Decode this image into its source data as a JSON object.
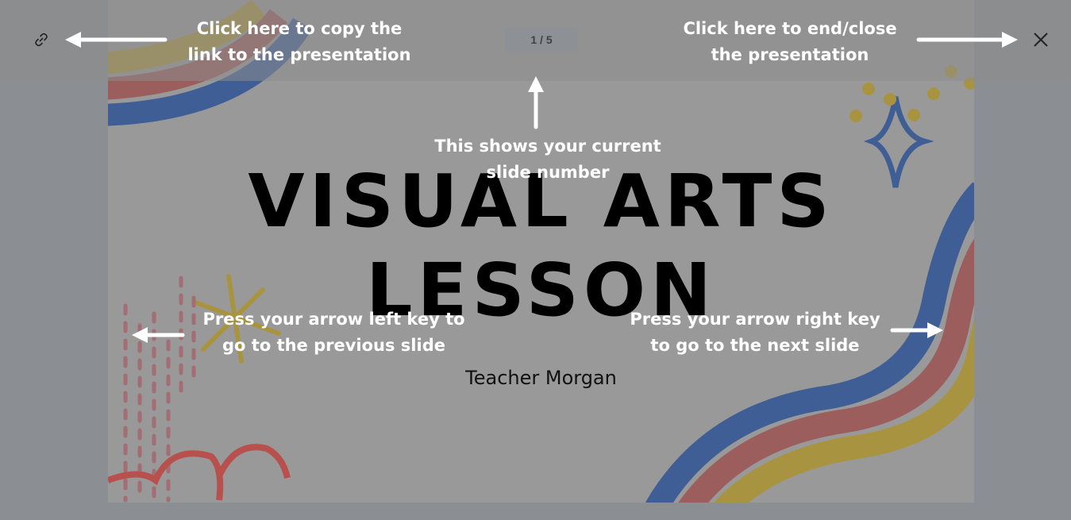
{
  "slide": {
    "title_line1": "VISUAL ARTS",
    "title_line2": "LESSON",
    "subtitle": "Teacher Morgan",
    "colors": {
      "background": "#9a9999",
      "blue": "#3f5e95",
      "red": "#9c5d5d",
      "yellow": "#a89440",
      "coral": "#b8504d"
    }
  },
  "toolbar": {
    "counter": "1 / 5",
    "link_icon": "link-icon",
    "close_icon": "close-icon"
  },
  "annotations": {
    "copy_link": [
      "Click here to copy the",
      "link to the presentation"
    ],
    "close": [
      "Click here to end/close",
      "the presentation"
    ],
    "slide_number": [
      "This shows your current",
      "slide number"
    ],
    "prev": [
      "Press your arrow left key to",
      "go to the previous slide"
    ],
    "next": [
      "Press your arrow right key",
      "to go to the next slide"
    ]
  }
}
